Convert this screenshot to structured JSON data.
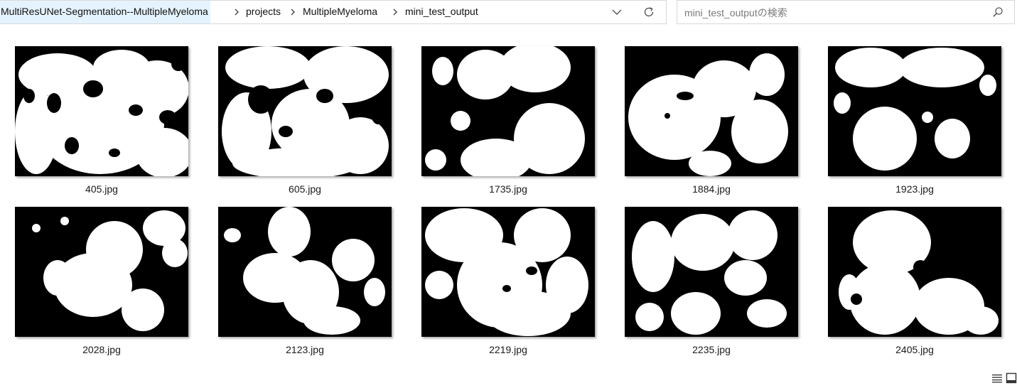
{
  "breadcrumb": [
    "MultiResUNet-Segmentation--MultipleMyeloma",
    "projects",
    "MultipleMyeloma",
    "mini_test_output"
  ],
  "search": {
    "placeholder": "mini_test_outputの検索"
  },
  "icons": {
    "separator": "chevron-right-icon",
    "history": "chevron-down-icon",
    "refresh": "refresh-icon",
    "search": "search-icon",
    "details_view": "details-view-icon",
    "thumbnail_view": "large-icons-view-icon"
  },
  "files": [
    {
      "name": "405.jpg"
    },
    {
      "name": "605.jpg"
    },
    {
      "name": "1735.jpg"
    },
    {
      "name": "1884.jpg"
    },
    {
      "name": "1923.jpg"
    },
    {
      "name": "2028.jpg"
    },
    {
      "name": "2123.jpg"
    },
    {
      "name": "2219.jpg"
    },
    {
      "name": "2235.jpg"
    },
    {
      "name": "2405.jpg"
    }
  ]
}
